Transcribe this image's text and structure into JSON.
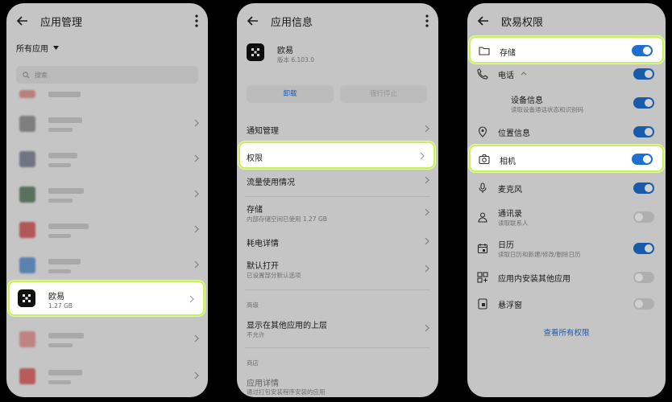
{
  "screen1": {
    "title": "应用管理",
    "filter_label": "所有应用",
    "search_placeholder": "搜索",
    "selected_app": {
      "name": "欧易",
      "size": "1.27 GB"
    }
  },
  "screen2": {
    "title": "应用信息",
    "app_name": "欧易",
    "version": "版本 6.103.0",
    "uninstall": "卸载",
    "force_stop": "强行停止",
    "rows": [
      {
        "title": "通知管理"
      },
      {
        "title": "权限"
      },
      {
        "title": "流量使用情况"
      },
      {
        "title": "存储",
        "sub": "内部存储空间已使用 1.27 GB"
      },
      {
        "title": "耗电详情"
      },
      {
        "title": "默认打开",
        "sub": "已设置部分默认选项"
      }
    ],
    "section_advanced": "高级",
    "overlay": {
      "title": "显示在其他应用的上层",
      "sub": "不允许"
    },
    "section_store": "商店",
    "app_details": {
      "title": "应用详情",
      "sub": "通过打包安装程序安装的应用"
    }
  },
  "screen3": {
    "title": "欧易权限",
    "permissions": [
      {
        "label": "存储",
        "icon": "folder-icon",
        "on": true
      },
      {
        "label": "电话",
        "icon": "phone-icon",
        "on": true
      },
      {
        "label": "设备信息",
        "sub": "读取设备通话状态和识别码",
        "on": true
      },
      {
        "label": "位置信息",
        "icon": "location-icon",
        "on": true
      },
      {
        "label": "相机",
        "icon": "camera-icon",
        "on": true
      },
      {
        "label": "麦克风",
        "icon": "microphone-icon",
        "on": true
      },
      {
        "label": "通讯录",
        "sub": "读取联系人",
        "icon": "contacts-icon",
        "on": false
      },
      {
        "label": "日历",
        "sub": "读取日历和新建/修改/删除日历",
        "icon": "calendar-icon",
        "on": true
      },
      {
        "label": "应用内安装其他应用",
        "icon": "apps-icon",
        "on": false
      },
      {
        "label": "悬浮窗",
        "icon": "floating-window-icon",
        "on": false
      }
    ],
    "view_all": "查看所有权限",
    "accent": "#1f6fd1"
  },
  "highlight_color": "#c9f05a"
}
